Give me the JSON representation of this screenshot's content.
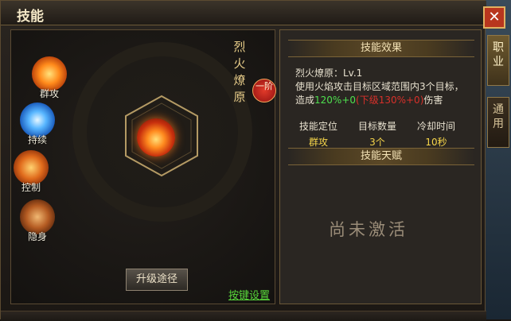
{
  "window": {
    "title": "技能"
  },
  "side_tabs": [
    {
      "label": "职业"
    },
    {
      "label": "通用"
    }
  ],
  "categories": [
    {
      "label": "群攻",
      "icon": "fire-burst-icon"
    },
    {
      "label": "持续",
      "icon": "water-swirl-icon"
    },
    {
      "label": "控制",
      "icon": "control-figure-icon"
    },
    {
      "label": "隐身",
      "icon": "stealth-figure-icon"
    }
  ],
  "skill": {
    "name_vertical": "烈火燎原",
    "stage": "一阶",
    "line": "烈火燎原：Lv.1",
    "desc_prefix": "使用火焰攻击目标区域范围内3个目标，造成",
    "desc_green": "120%+0",
    "desc_red": "(下级130%+0)",
    "desc_suffix": "伤害",
    "stats": [
      {
        "header": "技能定位",
        "value": "群攻"
      },
      {
        "header": "目标数量",
        "value": "3个"
      },
      {
        "header": "冷却时间",
        "value": "10秒"
      }
    ]
  },
  "sections": {
    "effect": "技能效果",
    "talent": "技能天赋"
  },
  "talent_status": "尚未激活",
  "buttons": {
    "upgrade": "升级途径",
    "keybind": "按键设置"
  },
  "colors": {
    "accent_gold": "#f6d54a",
    "green_value": "#4ee04e",
    "red_value": "#d8302a",
    "close_red": "#b8361e"
  }
}
